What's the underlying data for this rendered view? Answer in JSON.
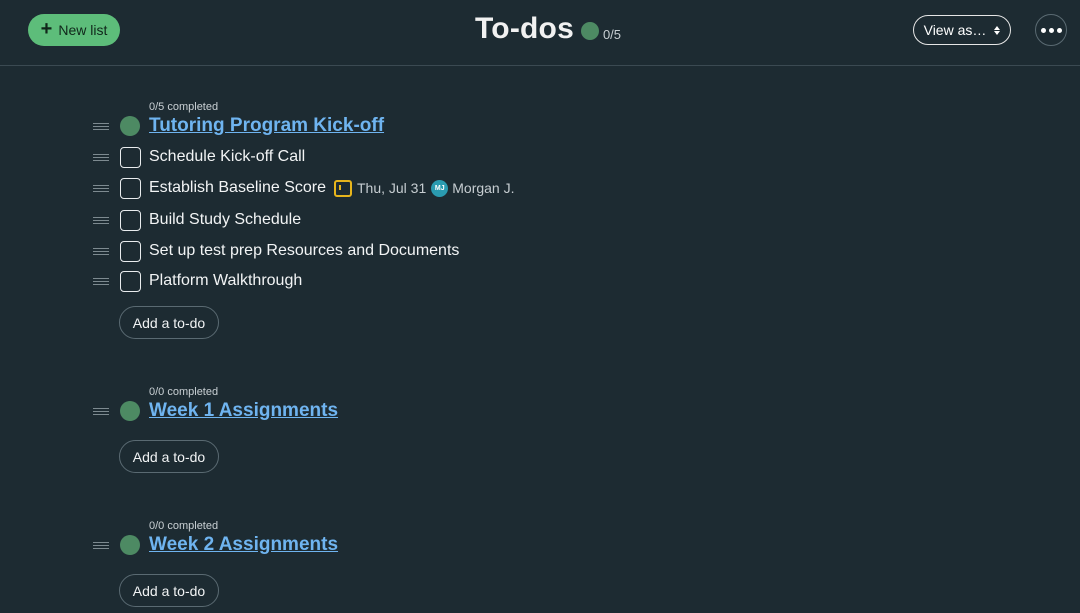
{
  "header": {
    "new_list_label": "New list",
    "title": "To-dos",
    "count": "0/5",
    "view_as_label": "View as…"
  },
  "lists": [
    {
      "completed": "0/5 completed",
      "title": "Tutoring Program Kick-off",
      "todos": [
        {
          "text": "Schedule Kick-off Call"
        },
        {
          "text": "Establish Baseline Score",
          "due": "Thu, Jul 31",
          "assignee_initials": "MJ",
          "assignee": "Morgan J."
        },
        {
          "text": "Build Study Schedule"
        },
        {
          "text": "Set up test prep Resources and Documents"
        },
        {
          "text": "Platform Walkthrough"
        }
      ],
      "add_label": "Add a to-do"
    },
    {
      "completed": "0/0 completed",
      "title": "Week 1 Assignments",
      "todos": [],
      "add_label": "Add a to-do"
    },
    {
      "completed": "0/0 completed",
      "title": "Week 2 Assignments",
      "todos": [],
      "add_label": "Add a to-do"
    }
  ],
  "colors": {
    "background": "#1d2b32",
    "accent_green": "#5dbd7a",
    "list_dot": "#4d8a63",
    "link_blue": "#6fb4f0",
    "calendar_yellow": "#e7b51c",
    "avatar_teal": "#2a9bb0"
  },
  "icons": [
    "plus-icon",
    "updown-chevron-icon",
    "more-dots-icon",
    "drag-handle-icon",
    "calendar-icon"
  ]
}
